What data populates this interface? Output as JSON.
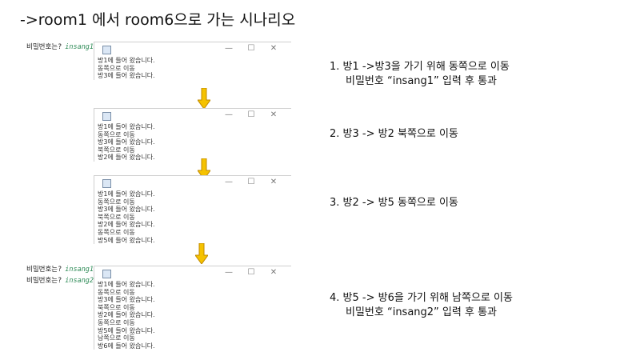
{
  "title": "->room1 에서 room6으로 가는 시나리오",
  "console1": {
    "prompt": "비밀번호는?",
    "input": "insang1"
  },
  "console2": [
    {
      "prompt": "비밀번호는?",
      "input": "insang1"
    },
    {
      "prompt": "비밀번호는?",
      "input": "insang2"
    }
  ],
  "window_controls": {
    "minimize": "—",
    "maximize": "☐",
    "close": "✕"
  },
  "windows": [
    [
      "방1에 들어 왔습니다.",
      "동쪽으로 이동",
      "방3에 들어 왔습니다."
    ],
    [
      "방1에 들어 왔습니다.",
      "동쪽으로 이동",
      "방3에 들어 왔습니다.",
      "북쪽으로 이동",
      "방2에 들어 왔습니다."
    ],
    [
      "방1에 들어 왔습니다.",
      "동쪽으로 이동",
      "방3에 들어 왔습니다.",
      "북쪽으로 이동",
      "방2에 들어 왔습니다.",
      "동쪽으로 이동",
      "방5에 들어 왔습니다."
    ],
    [
      "방1에 들어 왔습니다.",
      "동쪽으로 이동",
      "방3에 들어 왔습니다.",
      "북쪽으로 이동",
      "방2에 들어 왔습니다.",
      "동쪽으로 이동",
      "방5에 들어 왔습니다.",
      "남쪽으로 이동",
      "방6에 들어 왔습니다."
    ]
  ],
  "steps": [
    {
      "line1": "1.   방1 ->방3을 가기 위해 동쪽으로 이동",
      "line2": "비밀번호 “insang1” 입력 후 통과"
    },
    {
      "line1": "2. 방3 -> 방2 북쪽으로 이동",
      "line2": ""
    },
    {
      "line1": "3. 방2 -> 방5 동쪽으로 이동",
      "line2": ""
    },
    {
      "line1": "4. 방5 -> 방6을 가기 위해 남쪽으로 이동",
      "line2": "비밀번호 “insang2” 입력 후 통과"
    }
  ],
  "colors": {
    "arrow_fill": "#f5c200",
    "arrow_stroke": "#c08a00",
    "input_text": "#2e8b57"
  }
}
